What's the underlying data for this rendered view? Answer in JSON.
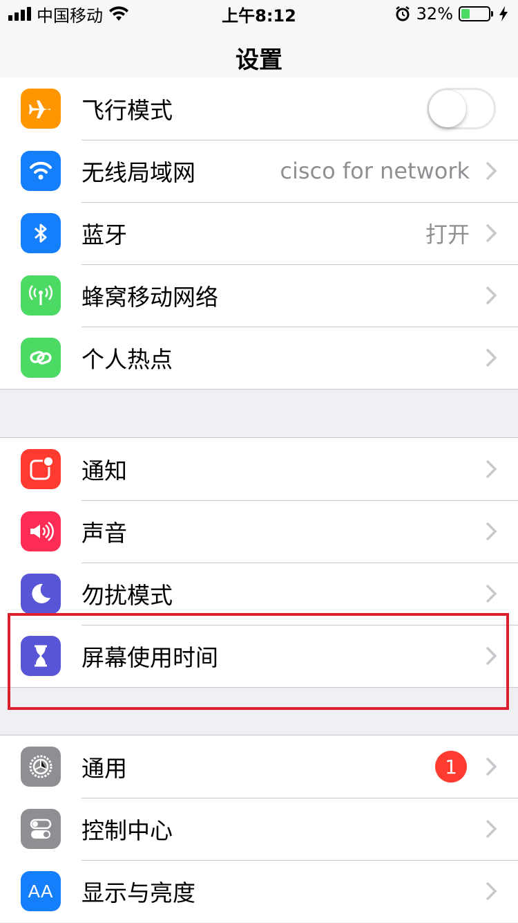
{
  "status_bar": {
    "carrier": "中国移动",
    "time": "上午8:12",
    "battery_percent": "32%",
    "battery_level": 0.32,
    "icons": [
      "signal-bars-icon",
      "wifi-icon",
      "alarm-icon",
      "battery-icon",
      "charging-bolt-icon"
    ]
  },
  "nav": {
    "title": "设置"
  },
  "sections": [
    {
      "rows": [
        {
          "label": "飞行模式",
          "icon": "airplane-icon",
          "icon_color": "#ff9500",
          "control": "toggle",
          "toggle_on": false
        },
        {
          "label": "无线局域网",
          "icon": "wifi-icon",
          "icon_color": "#147efb",
          "value": "cisco for network"
        },
        {
          "label": "蓝牙",
          "icon": "bluetooth-icon",
          "icon_color": "#147efb",
          "value": "打开"
        },
        {
          "label": "蜂窝移动网络",
          "icon": "cellular-antenna-icon",
          "icon_color": "#4cd964"
        },
        {
          "label": "个人热点",
          "icon": "hotspot-link-icon",
          "icon_color": "#4cd964"
        }
      ]
    },
    {
      "rows": [
        {
          "label": "通知",
          "icon": "notifications-icon",
          "icon_color": "#ff3b30"
        },
        {
          "label": "声音",
          "icon": "speaker-icon",
          "icon_color": "#ff2d55"
        },
        {
          "label": "勿扰模式",
          "icon": "moon-icon",
          "icon_color": "#5856d6"
        },
        {
          "label": "屏幕使用时间",
          "icon": "hourglass-icon",
          "icon_color": "#5856d6",
          "highlighted": true
        }
      ]
    },
    {
      "rows": [
        {
          "label": "通用",
          "icon": "gear-icon",
          "icon_color": "#8e8e93",
          "badge": "1"
        },
        {
          "label": "控制中心",
          "icon": "switches-icon",
          "icon_color": "#8e8e93"
        },
        {
          "label": "显示与亮度",
          "icon": "text-size-icon",
          "icon_color": "#147efb",
          "icon_text": "AA"
        }
      ]
    }
  ],
  "colors": {
    "background": "#efeff4",
    "separator": "#c8c7cc",
    "highlight": "#d9202c",
    "secondary_text": "#8e8e93"
  }
}
